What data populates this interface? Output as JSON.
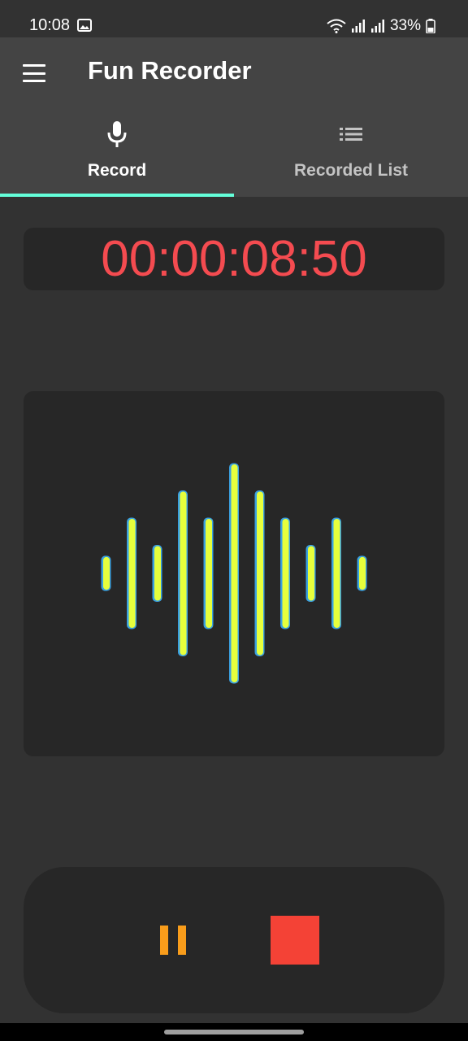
{
  "status_bar": {
    "time": "10:08",
    "battery_percent": "33%",
    "icons": [
      "image-icon",
      "wifi-icon",
      "signal-icon",
      "signal-icon",
      "battery-icon"
    ]
  },
  "app_bar": {
    "title": "Fun Recorder",
    "menu_icon": "menu-icon"
  },
  "tabs": [
    {
      "label": "Record",
      "icon": "mic-icon",
      "selected": true
    },
    {
      "label": "Recorded List",
      "icon": "list-icon",
      "selected": false
    }
  ],
  "timer": {
    "value": "00:00:08:50",
    "color": "#f44b50"
  },
  "waveform": {
    "bar_color": "#e6ff3c",
    "outline_color": "#3aa0e0",
    "levels": [
      0.15,
      0.5,
      0.25,
      0.75,
      0.5,
      1.0,
      0.75,
      0.5,
      0.25,
      0.5,
      0.15
    ]
  },
  "controls": {
    "pause_icon": "pause-icon",
    "pause_color": "#f99d1b",
    "stop_icon": "stop-icon",
    "stop_color": "#f44236"
  },
  "colors": {
    "background": "#323232",
    "app_bar": "#444444",
    "card": "#272727",
    "tab_indicator": "#64ffda"
  }
}
